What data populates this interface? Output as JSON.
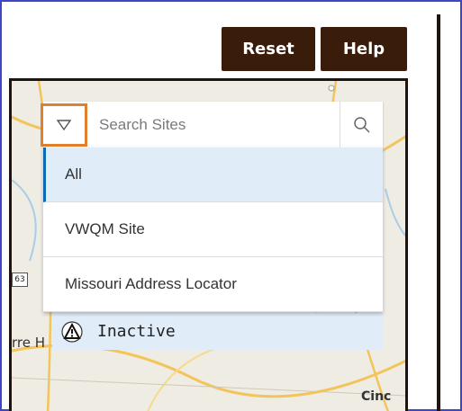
{
  "toolbar": {
    "reset_label": "Reset",
    "help_label": "Help"
  },
  "search": {
    "placeholder": "Search Sites",
    "value": "",
    "toggle_icon": "triangle-down-icon",
    "search_icon": "magnifier-icon"
  },
  "dropdown": {
    "options": [
      {
        "label": "All",
        "selected": true
      },
      {
        "label": "VWQM Site",
        "selected": false
      },
      {
        "label": "Missouri Address Locator",
        "selected": false
      }
    ]
  },
  "legend": {
    "inactive_label": "Inactive",
    "inactive_icon": "warning-triangle-icon"
  },
  "map": {
    "labels": {
      "terre": "rre H",
      "cinc": "Cinc",
      "route": "63"
    }
  },
  "colors": {
    "button_bg": "#3a1c0a",
    "toggle_border": "#e07f2c",
    "selected_bg": "#e0ecf8",
    "selected_accent": "#0a6ab3",
    "frame_border": "#3d46c9"
  }
}
